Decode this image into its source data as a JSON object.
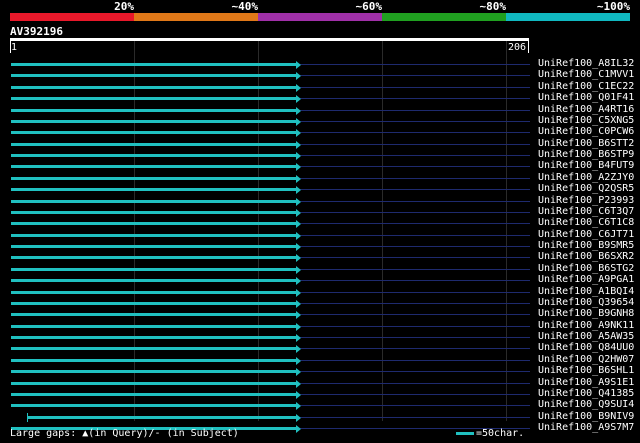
{
  "scale": {
    "labels": [
      "20%",
      "~40%",
      "~60%",
      "~80%",
      "~100%"
    ],
    "colors": [
      "#e8182a",
      "#e07818",
      "#a030a8",
      "#20a020",
      "#10b8c0"
    ]
  },
  "query": {
    "id": "AV392196",
    "start": "1",
    "end": "206"
  },
  "hits": [
    {
      "name": "UniRef100_A8IL32",
      "start_frac": 0.0
    },
    {
      "name": "UniRef100_C1MVV1",
      "start_frac": 0.0
    },
    {
      "name": "UniRef100_C1EC22",
      "start_frac": 0.0
    },
    {
      "name": "UniRef100_Q01F41",
      "start_frac": 0.0
    },
    {
      "name": "UniRef100_A4RT16",
      "start_frac": 0.0
    },
    {
      "name": "UniRef100_C5XNG5",
      "start_frac": 0.0
    },
    {
      "name": "UniRef100_C0PCW6",
      "start_frac": 0.0
    },
    {
      "name": "UniRef100_B6STT2",
      "start_frac": 0.0
    },
    {
      "name": "UniRef100_B6STP9",
      "start_frac": 0.0
    },
    {
      "name": "UniRef100_B4FUT9",
      "start_frac": 0.0
    },
    {
      "name": "UniRef100_A2ZJY0",
      "start_frac": 0.0
    },
    {
      "name": "UniRef100_Q2QSR5",
      "start_frac": 0.0
    },
    {
      "name": "UniRef100_P23993",
      "start_frac": 0.0
    },
    {
      "name": "UniRef100_C6T3Q7",
      "start_frac": 0.0
    },
    {
      "name": "UniRef100_C6T1C8",
      "start_frac": 0.0
    },
    {
      "name": "UniRef100_C6JT71",
      "start_frac": 0.0
    },
    {
      "name": "UniRef100_B9SMR5",
      "start_frac": 0.0
    },
    {
      "name": "UniRef100_B6SXR2",
      "start_frac": 0.0
    },
    {
      "name": "UniRef100_B6STG2",
      "start_frac": 0.0
    },
    {
      "name": "UniRef100_A9PGA1",
      "start_frac": 0.0
    },
    {
      "name": "UniRef100_A1BQI4",
      "start_frac": 0.0
    },
    {
      "name": "UniRef100_Q39654",
      "start_frac": 0.0
    },
    {
      "name": "UniRef100_B9GNH8",
      "start_frac": 0.0
    },
    {
      "name": "UniRef100_A9NK11",
      "start_frac": 0.0
    },
    {
      "name": "UniRef100_A5AW35",
      "start_frac": 0.0
    },
    {
      "name": "UniRef100_Q84UU0",
      "start_frac": 0.0
    },
    {
      "name": "UniRef100_Q2HW07",
      "start_frac": 0.0
    },
    {
      "name": "UniRef100_B6SHL1",
      "start_frac": 0.0
    },
    {
      "name": "UniRef100_A9S1E1",
      "start_frac": 0.0
    },
    {
      "name": "UniRef100_Q41385",
      "start_frac": 0.0
    },
    {
      "name": "UniRef100_Q9SUI4",
      "start_frac": 0.0
    },
    {
      "name": "UniRef100_B9NIV9",
      "start_frac": 0.055
    },
    {
      "name": "UniRef100_A9S7M7",
      "start_frac": 0.0
    }
  ],
  "legend": {
    "prefix": "Large gaps:",
    "query_glyph": "▲",
    "query_text": "(in Query)/",
    "subject_glyph": "-",
    "subject_text": " (in Subject)",
    "scale_text": "=50char."
  }
}
